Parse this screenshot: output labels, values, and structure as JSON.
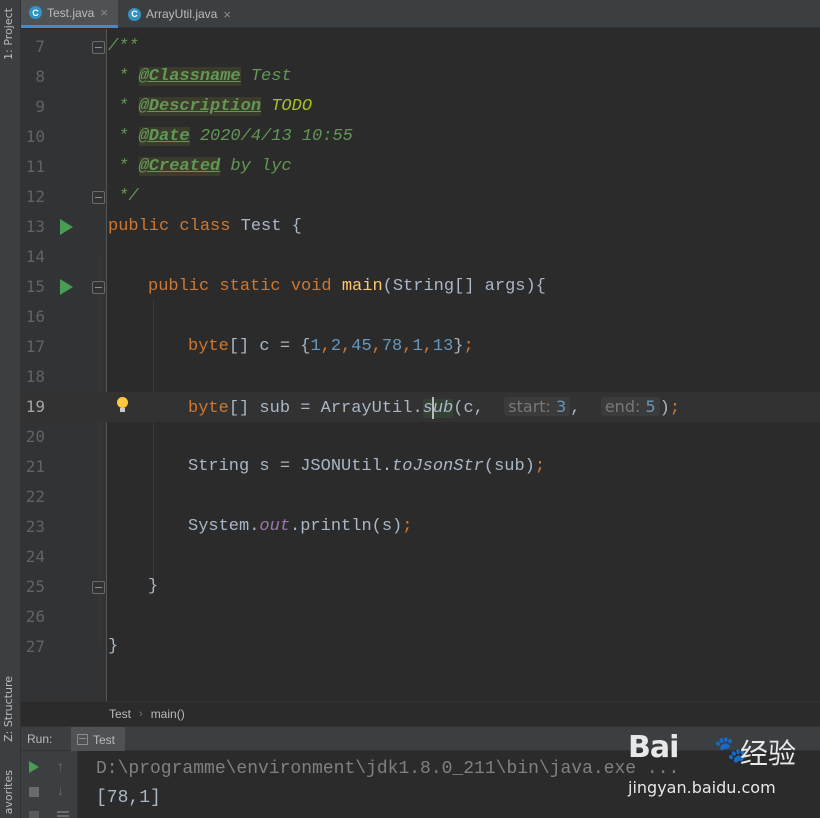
{
  "side_panels": {
    "project": "1: Project",
    "structure": "Z: Structure",
    "favorites": "avorites"
  },
  "tabs": [
    {
      "label": "Test.java",
      "close": "×",
      "icon_letter": "C"
    },
    {
      "label": "ArrayUtil.java",
      "close": "×",
      "icon_letter": "C"
    }
  ],
  "line_numbers": [
    "7",
    "8",
    "9",
    "10",
    "11",
    "12",
    "13",
    "14",
    "15",
    "16",
    "17",
    "18",
    "19",
    "20",
    "21",
    "22",
    "23",
    "24",
    "25",
    "26",
    "27"
  ],
  "code": {
    "l7": {
      "open": "/**"
    },
    "l8": {
      "star": " * ",
      "tag": "@Classname",
      "rest": " Test"
    },
    "l9": {
      "star": " * ",
      "tag": "@Description",
      "rest": " TODO"
    },
    "l10": {
      "star": " * ",
      "tag": "@Date",
      "rest": " 2020/4/13 10:55"
    },
    "l11": {
      "star": " * ",
      "tag": "@Created",
      "rest": " by lyc"
    },
    "l12": {
      "close": " */"
    },
    "l13": {
      "kw": "public class",
      "rest": " Test {"
    },
    "l15": {
      "kw": "public static void",
      "fn": "main",
      "rest": "(String[] args){"
    },
    "l17": {
      "kw": "byte",
      "mid": "[] c = {",
      "n1": "1",
      "n2": "2",
      "n3": "45",
      "n4": "78",
      "n5": "1",
      "n6": "13",
      "comma": ",",
      "end": "}",
      "semi": ";"
    },
    "l19": {
      "kw": "byte",
      "mid": "[] sub = ArrayUtil.",
      "call_a": "s",
      "call_b": "ub",
      "paren": "(c,",
      "hint_start_name": "start:",
      "hint_start_val": "3",
      "comma": ",",
      "hint_end_name": "end:",
      "hint_end_val": "5",
      "close": ")",
      "semi": ";"
    },
    "l21": {
      "pre": "String s = JSONUtil.",
      "call": "toJsonStr",
      "rest": "(sub)",
      "semi": ";"
    },
    "l23": {
      "pre": "System.",
      "field": "out",
      "rest": ".println(s)",
      "semi": ";"
    },
    "l25": {
      "brace": "}"
    },
    "l27": {
      "brace": "}"
    }
  },
  "breadcrumb": {
    "class": "Test",
    "sep": "›",
    "method": "main()"
  },
  "run_panel": {
    "label": "Run:",
    "tab": "Test",
    "command": "D:\\programme\\environment\\jdk1.8.0_211\\bin\\java.exe ...",
    "output": "[78,1]",
    "up_arrow": "↑",
    "down_arrow": "↓"
  },
  "watermark": {
    "logo": "Bai",
    "paw": "🐾",
    "cn": "经验",
    "url": "jingyan.baidu.com"
  },
  "colors": {
    "editor_bg": "#2b2b2b",
    "keyword": "#cc7832",
    "comment": "#629755",
    "number": "#6897bb",
    "method": "#ffc66d",
    "field": "#9876aa",
    "run_green": "#499c54"
  }
}
